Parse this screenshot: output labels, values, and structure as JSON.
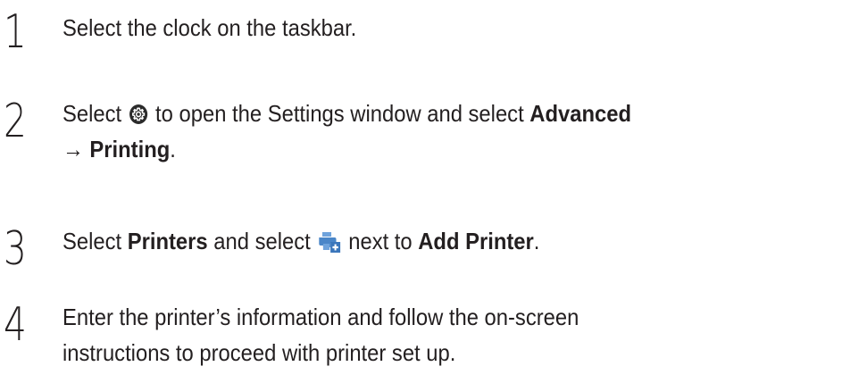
{
  "steps": [
    {
      "number": "1",
      "text": "Select the clock on the taskbar."
    },
    {
      "number": "2",
      "part1": "Select ",
      "part2": " to open the Settings window and select ",
      "bold1": "Advanced",
      "arrow": "→ ",
      "bold2": "Printing",
      "end": ".",
      "icon": "settings-gear-icon"
    },
    {
      "number": "3",
      "part1": "Select ",
      "bold1": "Printers",
      "part2": " and select ",
      "part3": " next to ",
      "bold2": "Add Printer",
      "end": ".",
      "icon": "add-printer-icon"
    },
    {
      "number": "4",
      "line1": "Enter the printer’s information and follow the on-screen",
      "line2": "instructions to proceed with printer set up."
    }
  ],
  "colors": {
    "text": "#231f20",
    "printer_icon_blue": "#4a86c8",
    "printer_icon_plus": "#ffffff"
  }
}
